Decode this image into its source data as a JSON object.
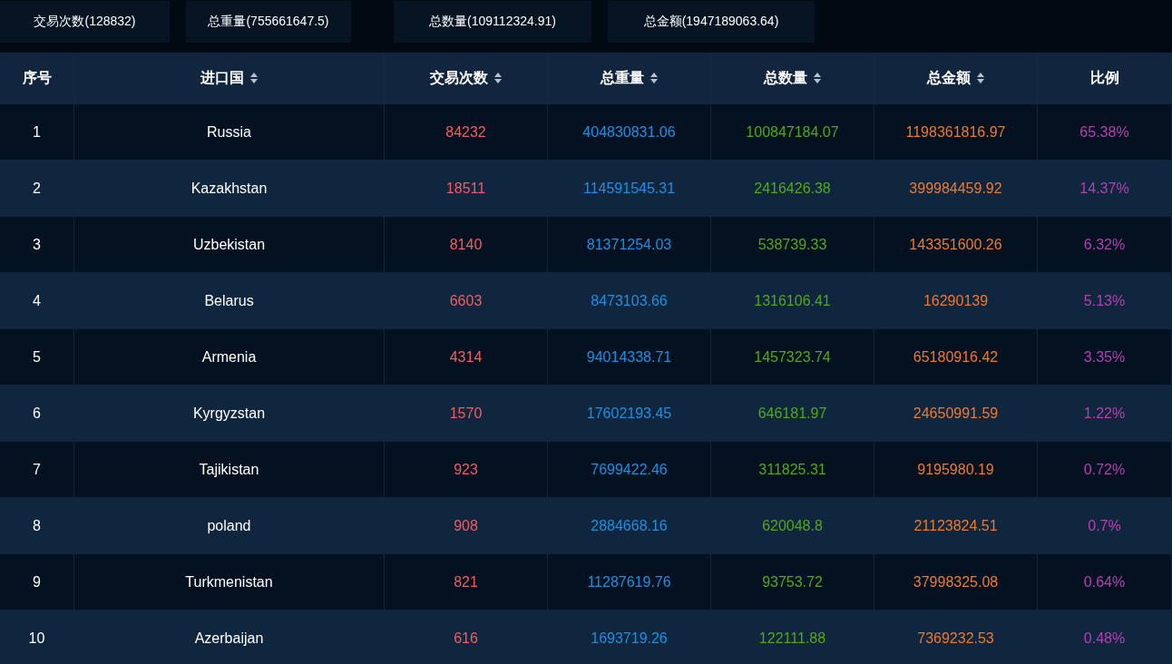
{
  "summary": [
    {
      "label": "交易次数(128832)"
    },
    {
      "label": "总重量(755661647.5)"
    },
    {
      "label": "总数量(109112324.91)"
    },
    {
      "label": "总金额(1947189063.64)"
    }
  ],
  "table": {
    "columns": [
      {
        "label": "序号",
        "sortable": false,
        "kind": "index"
      },
      {
        "label": "进口国",
        "sortable": true,
        "kind": "name"
      },
      {
        "label": "交易次数",
        "sortable": true,
        "kind": "count"
      },
      {
        "label": "总重量",
        "sortable": true,
        "kind": "weight"
      },
      {
        "label": "总数量",
        "sortable": true,
        "kind": "quantity"
      },
      {
        "label": "总金额",
        "sortable": true,
        "kind": "amount"
      },
      {
        "label": "比例",
        "sortable": false,
        "kind": "share"
      }
    ],
    "rows": [
      [
        "1",
        "Russia",
        "84232",
        "404830831.06",
        "100847184.07",
        "1198361816.97",
        "65.38%"
      ],
      [
        "2",
        "Kazakhstan",
        "18511",
        "114591545.31",
        "2416426.38",
        "399984459.92",
        "14.37%"
      ],
      [
        "3",
        "Uzbekistan",
        "8140",
        "81371254.03",
        "538739.33",
        "143351600.26",
        "6.32%"
      ],
      [
        "4",
        "Belarus",
        "6603",
        "8473103.66",
        "1316106.41",
        "16290139",
        "5.13%"
      ],
      [
        "5",
        "Armenia",
        "4314",
        "94014338.71",
        "1457323.74",
        "65180916.42",
        "3.35%"
      ],
      [
        "6",
        "Kyrgyzstan",
        "1570",
        "17602193.45",
        "646181.97",
        "24650991.59",
        "1.22%"
      ],
      [
        "7",
        "Tajikistan",
        "923",
        "7699422.46",
        "311825.31",
        "9195980.19",
        "0.72%"
      ],
      [
        "8",
        "poland",
        "908",
        "2884668.16",
        "620048.8",
        "21123824.51",
        "0.7%"
      ],
      [
        "9",
        "Turkmenistan",
        "821",
        "11287619.76",
        "93753.72",
        "37998325.08",
        "0.64%"
      ],
      [
        "10",
        "Azerbaijan",
        "616",
        "1693719.26",
        "122111.88",
        "7369232.53",
        "0.48%"
      ]
    ]
  }
}
